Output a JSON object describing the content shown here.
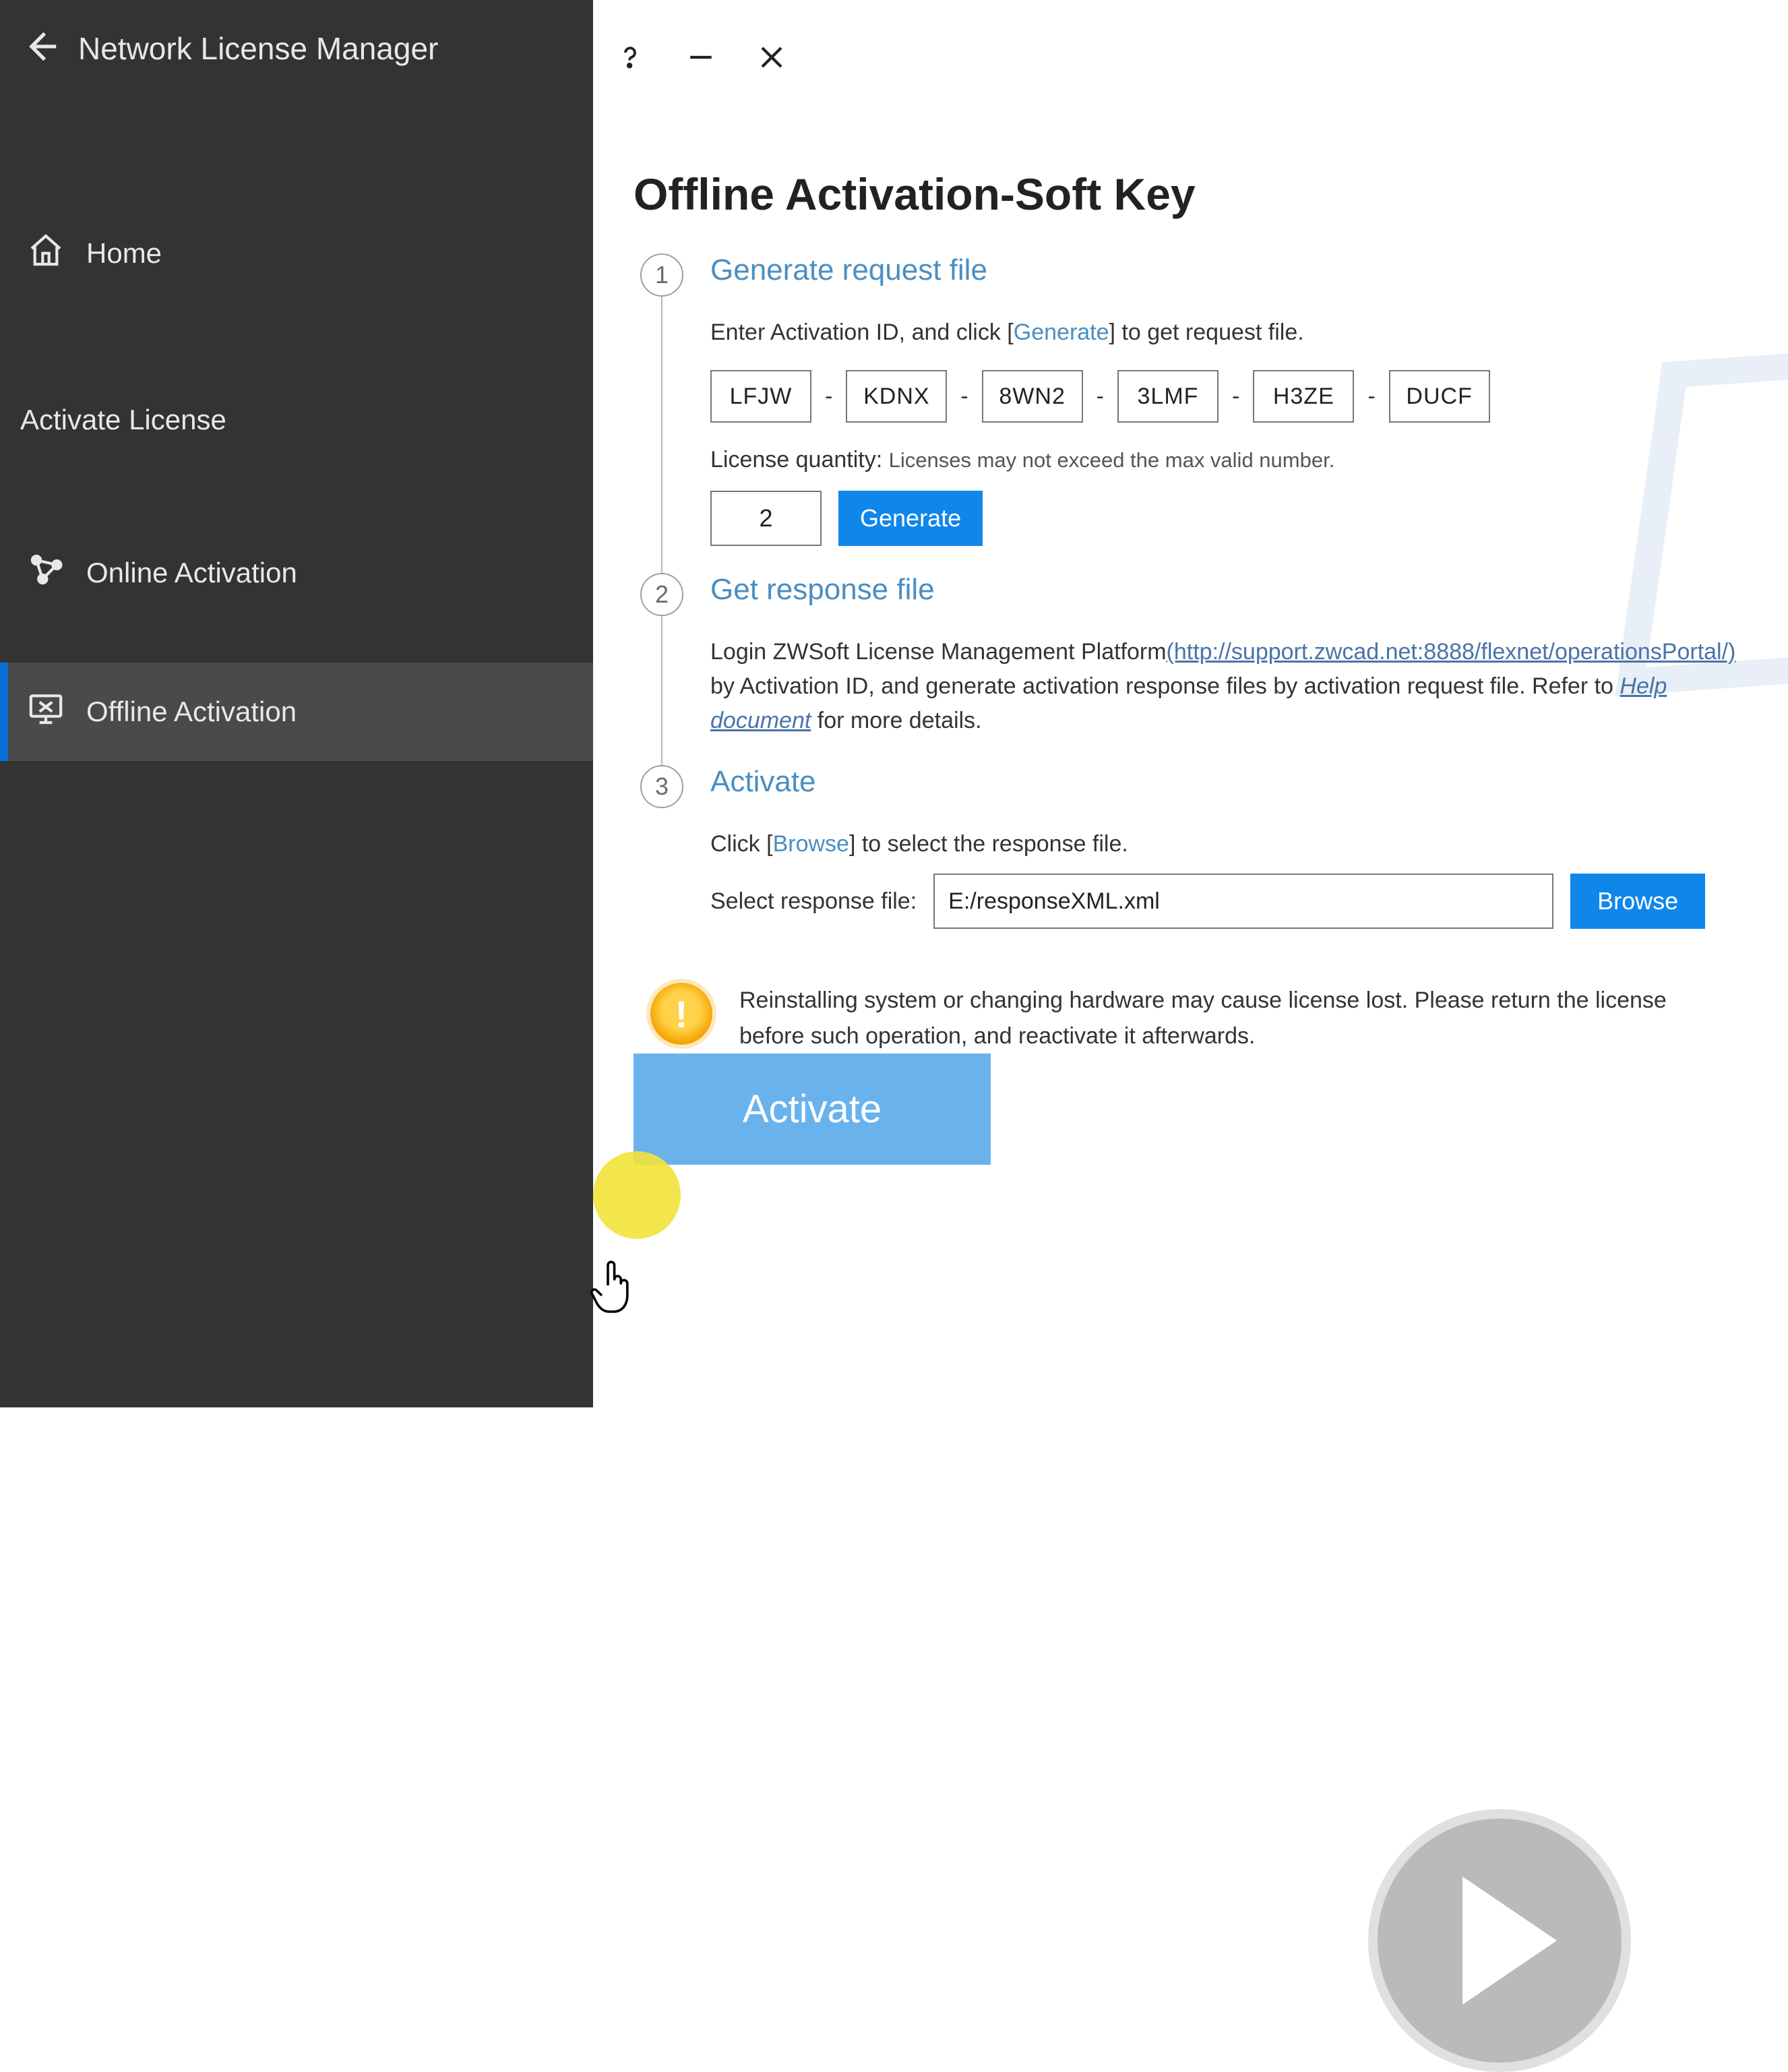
{
  "window": {
    "title": "Network License Manager"
  },
  "sidebar": {
    "home": "Home",
    "section": "Activate License",
    "online": "Online Activation",
    "offline": "Offline Activation"
  },
  "page": {
    "title": "Offline Activation-Soft Key"
  },
  "step1": {
    "num": "1",
    "title": "Generate request file",
    "instr_pre": "Enter Activation ID, and click [",
    "instr_link": "Generate",
    "instr_post": "] to get request file.",
    "key": [
      "LFJW",
      "KDNX",
      "8WN2",
      "3LMF",
      "H3ZE",
      "DUCF"
    ],
    "dash": "-",
    "qty_label": "License quantity:",
    "qty_hint": "Licenses may not exceed the max valid number.",
    "qty_value": "2",
    "generate_btn": "Generate"
  },
  "step2": {
    "num": "2",
    "title": "Get response file",
    "txt_a": "Login ZWSoft License Management Platform",
    "link_url": "(http://support.zwcad.net:8888/flexnet/operationsPortal/)",
    "txt_b": " by Activation ID, and generate activation response files by activation request file. Refer to ",
    "help_link": "Help document",
    "txt_c": " for more details."
  },
  "step3": {
    "num": "3",
    "title": "Activate",
    "instr_pre": "Click [",
    "instr_link": "Browse",
    "instr_post": "] to select the response file.",
    "resp_label": "Select response file:",
    "resp_value": "E:/responseXML.xml",
    "browse_btn": "Browse"
  },
  "warning": {
    "text": "Reinstalling system or changing hardware may cause license lost. Please return the license before such operation, and reactivate it afterwards."
  },
  "footer": {
    "activate_btn": "Activate"
  }
}
